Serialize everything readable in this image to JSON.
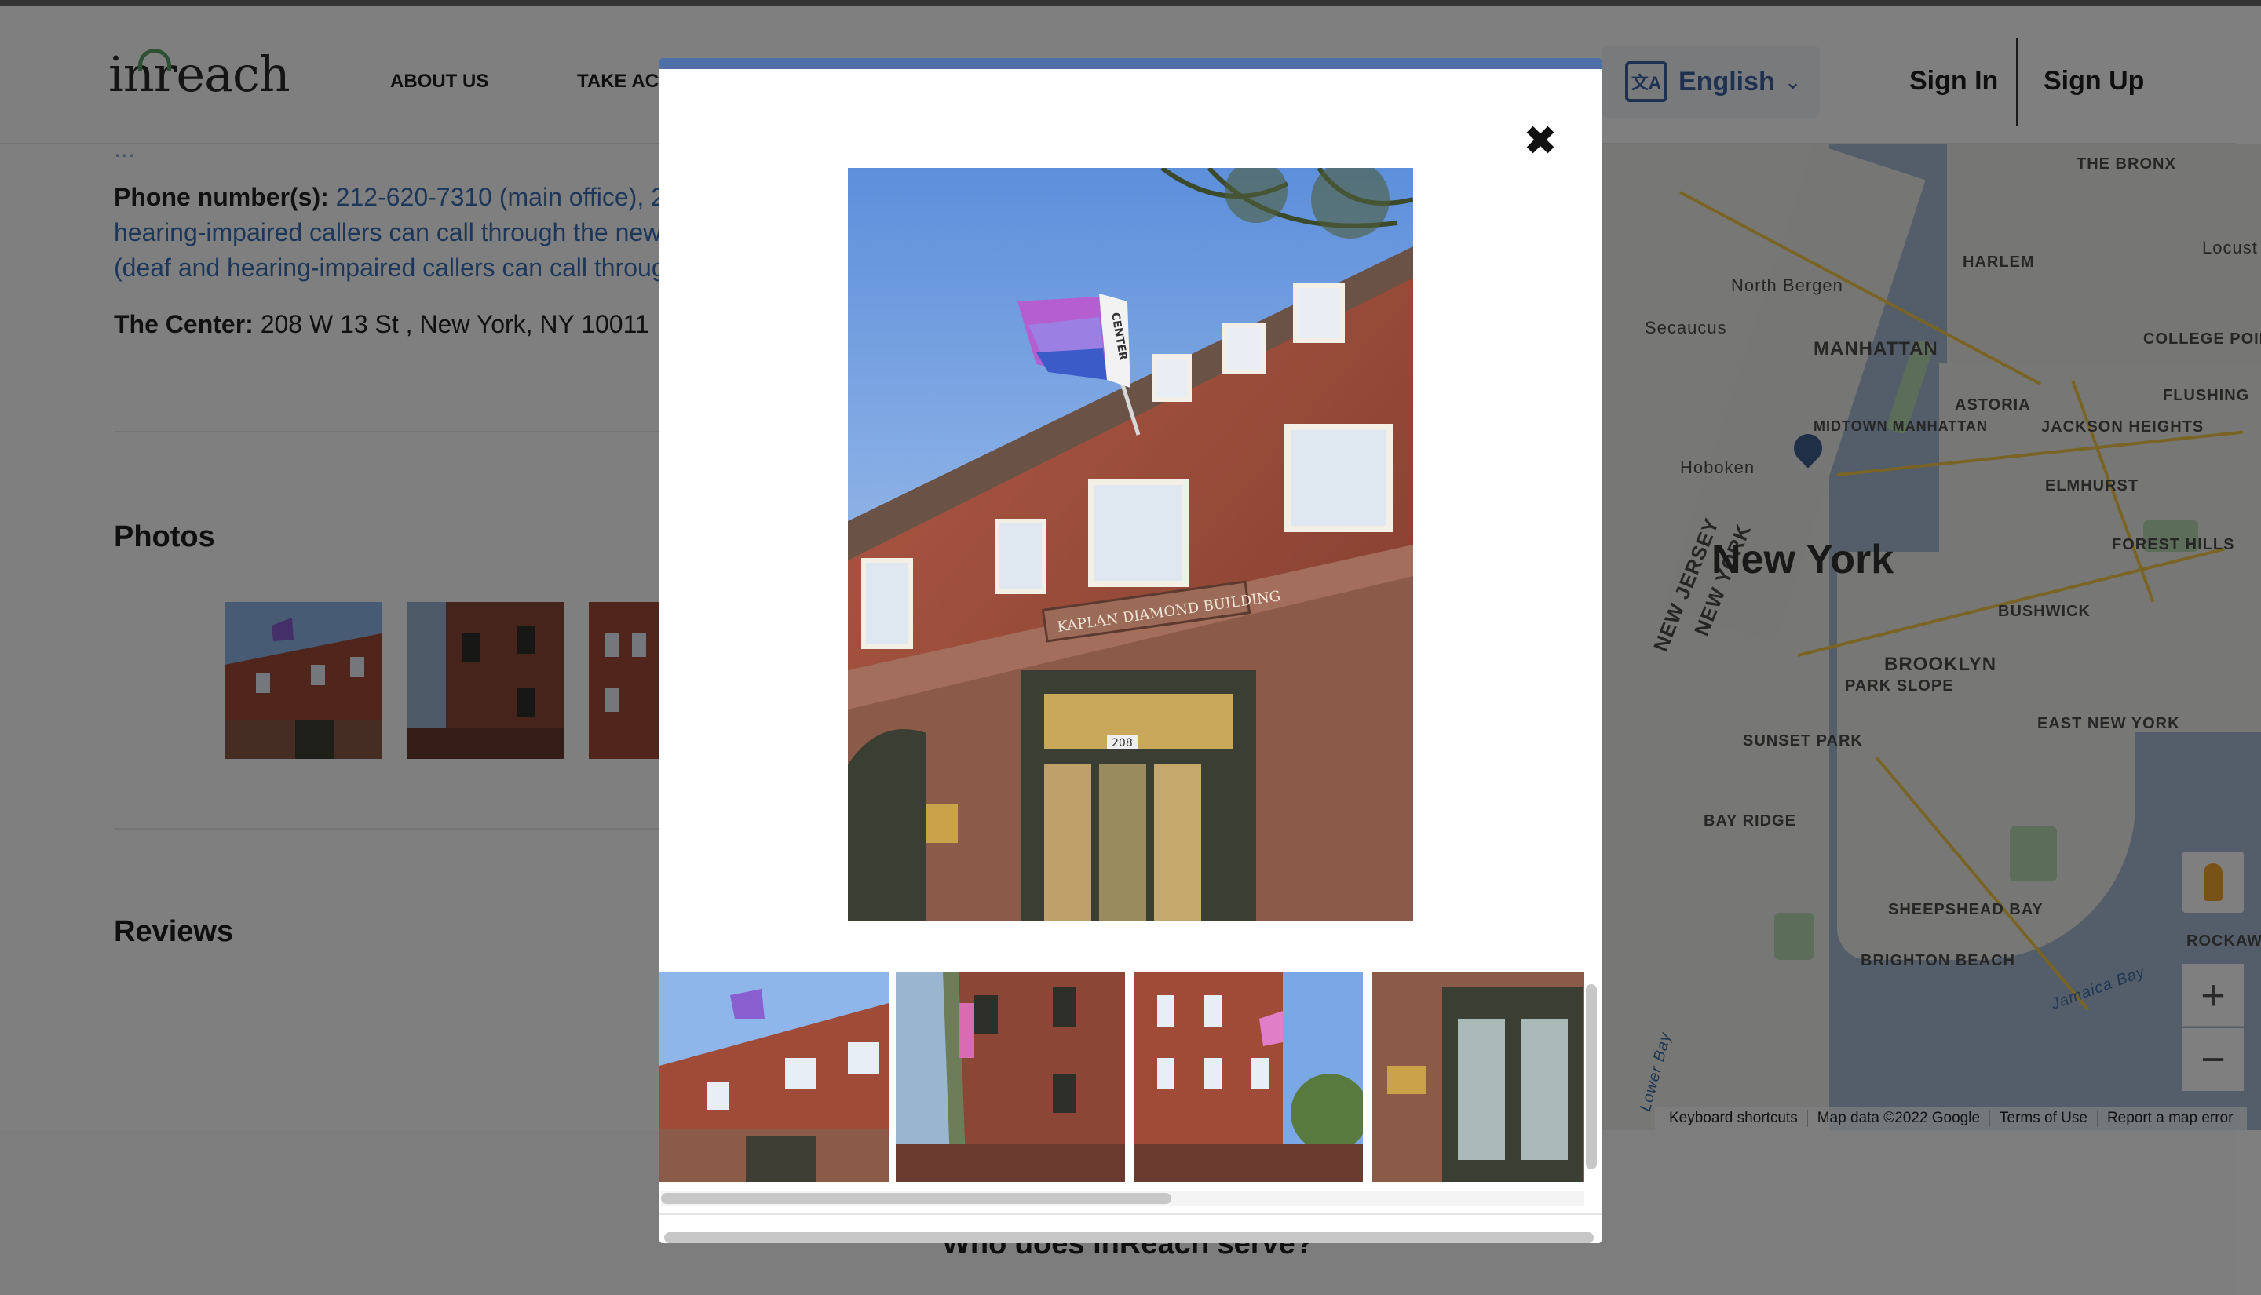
{
  "header": {
    "logo": "inreach",
    "nav": [
      "ABOUT US",
      "TAKE ACTI"
    ],
    "language": "English",
    "sign_in": "Sign In",
    "sign_up": "Sign Up"
  },
  "content": {
    "partial_text": "...",
    "phone_label": "Phone number(s):",
    "phone_line1": "212-620-7310 (main office), 2",
    "phone_line2": "hearing-impaired callers can call through the new",
    "phone_line3": "(deaf and hearing-impaired callers can call throug",
    "address_label": "The Center:",
    "address_value": "208 W 13 St , New York, NY 10011",
    "photos_title": "Photos",
    "reviews_title": "Reviews"
  },
  "footer": {
    "title": "Who does inReach serve?"
  },
  "map": {
    "big_label": "New York",
    "labels": [
      "THE BRONX",
      "HARLEM",
      "North Bergen",
      "Secaucus",
      "MANHATTAN",
      "ASTORIA",
      "COLLEGE POINT",
      "FLUSHING",
      "JACKSON HEIGHTS",
      "ELMHURST",
      "Hoboken",
      "MIDTOWN MANHATTAN",
      "FOREST HILLS",
      "BUSHWICK",
      "BROOKLYN",
      "PARK SLOPE",
      "EAST NEW YORK",
      "SUNSET PARK",
      "BAY RIDGE",
      "SHEEPSHEAD BAY",
      "BRIGHTON BEACH",
      "Locust",
      "NEW JERSEY",
      "NEW YORK",
      "ROCKAWAY BEACH",
      "Jamaica Bay",
      "Lower Bay"
    ],
    "footer_links": [
      "Keyboard shortcuts",
      "Map data ©2022 Google",
      "Terms of Use",
      "Report a map error"
    ],
    "zoom_in": "+",
    "zoom_out": "−"
  },
  "modal": {
    "close_symbol": "✖",
    "main_photo_alt": "The Center building with KAPLAN DIAMOND BUILDING sign",
    "sign_text": "KAPLAN DIAMOND BUILDING",
    "door_number": "208",
    "flag_text": "CENTER",
    "thumbnail_count": 4
  },
  "colors": {
    "accent": "#4f6fa8",
    "link": "#3a6fb5",
    "brick": "#9c4a3a",
    "stone": "#8b5a48",
    "sky": "#8fb6ea"
  }
}
